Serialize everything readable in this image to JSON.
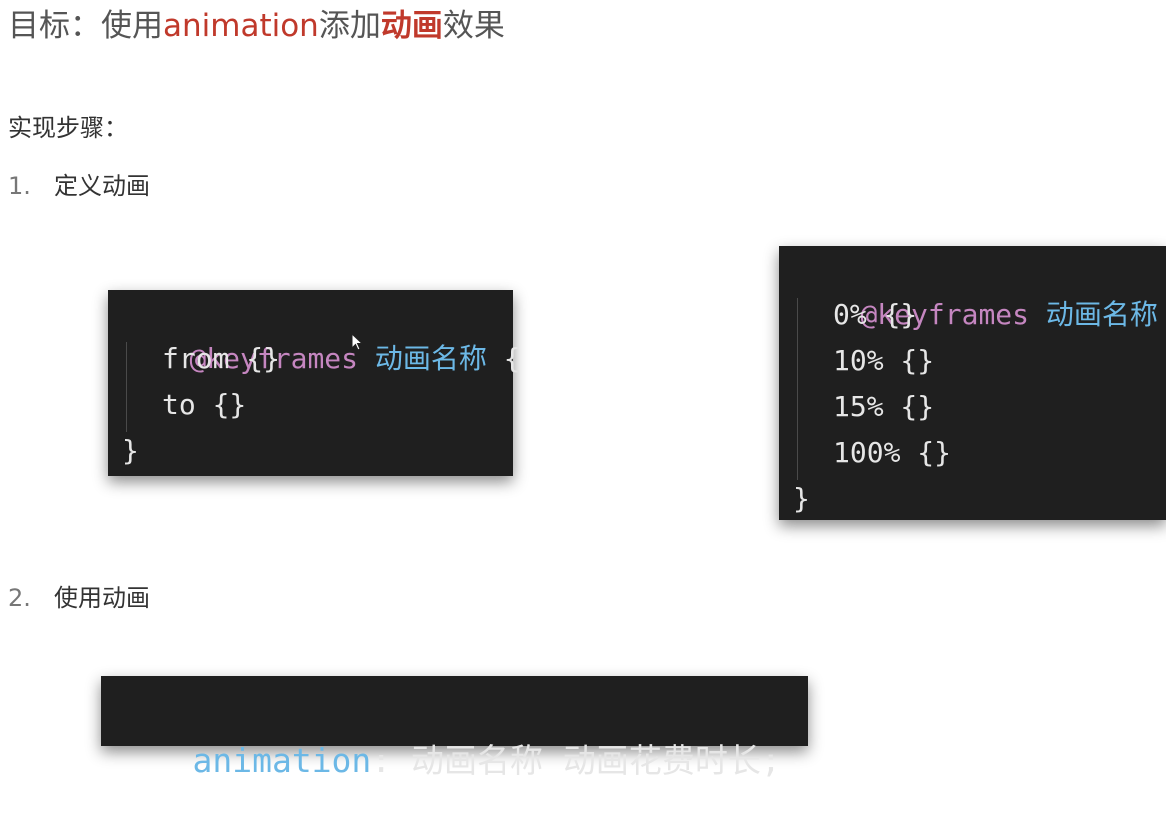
{
  "title": {
    "prefix": "目标：使用",
    "animation_word": "animation",
    "middle": "添加",
    "emphasis": "动画",
    "suffix": "效果"
  },
  "steps_heading": "实现步骤：",
  "step1": {
    "number": "1.",
    "label": "定义动画"
  },
  "step2": {
    "number": "2.",
    "label": "使用动画"
  },
  "code_from_to": {
    "at_rule": "@keyframes",
    "name": "动画名称",
    "open_brace": "{",
    "lines": [
      "from {}",
      "to {}"
    ],
    "close_brace": "}"
  },
  "code_percent": {
    "at_rule": "@keyframes",
    "name": "动画名称",
    "open_brace": "{",
    "lines": [
      "0% {}",
      "10% {}",
      "15% {}",
      "100% {}"
    ],
    "close_brace": "}"
  },
  "code_usage": {
    "property": "animation",
    "colon": ":",
    "value": " 动画名称 动画花费时长;"
  },
  "colors": {
    "accent_red": "#c0392b",
    "code_bg": "#1f1f1f",
    "keyword": "#c586c0",
    "identifier": "#6cb8e6"
  },
  "icons": {
    "cursor": "mouse-pointer-icon"
  }
}
